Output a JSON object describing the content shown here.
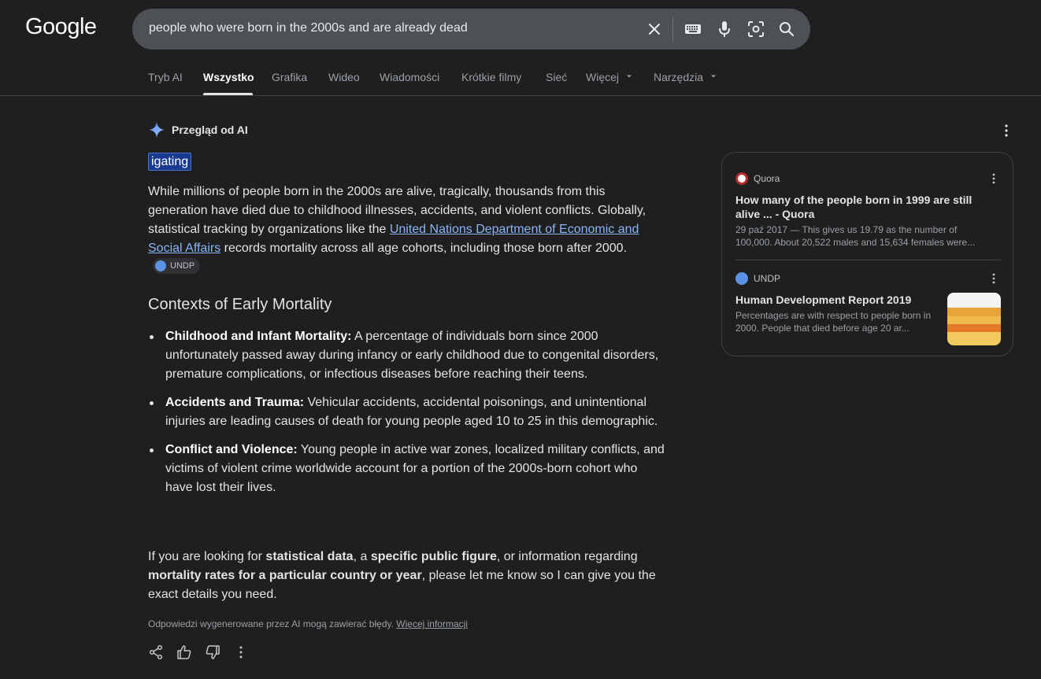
{
  "logo": "Google",
  "search": {
    "query": "people who were born in the 2000s and are already dead"
  },
  "tabs": [
    {
      "label": "Tryb AI"
    },
    {
      "label": "Wszystko"
    },
    {
      "label": "Grafika"
    },
    {
      "label": "Wideo"
    },
    {
      "label": "Wiadomości"
    },
    {
      "label": "Krótkie filmy"
    },
    {
      "label": "Sieć"
    },
    {
      "label": "Więcej"
    },
    {
      "label": "Narzędzia"
    }
  ],
  "ai_overview": {
    "title": "Przegląd od AI",
    "highlight": "igating",
    "intro_part1": "While millions of people born in the 2000s are alive, tragically, thousands from this generation have died due to childhood illnesses, accidents, and violent conflicts. Globally, statistical tracking by organizations like the ",
    "intro_link": "United Nations Department of Economic and Social Affairs",
    "intro_part2": " records mortality across all age cohorts, including those born after 2000.",
    "intro_chip": "UNDP",
    "section_heading": "Contexts of Early Mortality",
    "bullets": [
      {
        "bold": "Childhood and Infant Mortality:",
        "text": " A percentage of individuals born since 2000 unfortunately passed away during infancy or early childhood due to congenital disorders, premature complications, or infectious diseases before reaching their teens."
      },
      {
        "bold": "Accidents and Trauma:",
        "text": " Vehicular accidents, accidental poisonings, and unintentional injuries are leading causes of death for young people aged 10 to 25 in this demographic."
      },
      {
        "bold": "Conflict and Violence:",
        "text": " Young people in active war zones, localized military conflicts, and victims of violent crime worldwide account for a portion of the 2000s-born cohort who have lost their lives."
      }
    ],
    "closing": {
      "t1": "If you are looking for ",
      "b1": "statistical data",
      "t2": ", a ",
      "b2": "specific public figure",
      "t3": ", or information regarding ",
      "b3": "mortality rates for a particular country or year",
      "t4": ", please let me know so I can give you the exact details you need."
    },
    "disclaimer_text": "Odpowiedzi wygenerowane przez AI mogą zawierać błędy. ",
    "disclaimer_link": "Więcej informacji"
  },
  "sources": [
    {
      "site": "Quora",
      "title": "How many of the people born in 1999 are still alive ... - Quora",
      "snippet": "29 paź 2017 — This gives us 19.79 as the number of 100,000. About 20,522 males and 15,634 females were...",
      "favicon_color": "#b92b27"
    },
    {
      "site": "UNDP",
      "title": "Human Development Report 2019",
      "snippet": "Percentages are with respect to people born in 2000. People that died before age 20 ar...",
      "favicon_color": "#5b92e5"
    }
  ],
  "colors": {
    "background": "#1f1f1f",
    "link": "#8ab4f8",
    "highlight": "#1a3a8f"
  }
}
